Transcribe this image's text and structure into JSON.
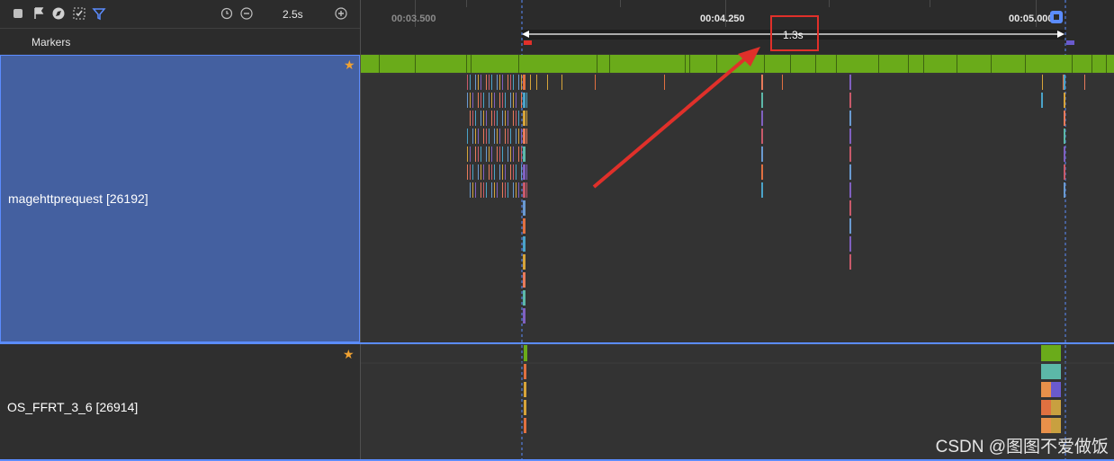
{
  "toolbar": {
    "icons": [
      "square-icon",
      "flag-icon",
      "compass-icon",
      "select-range-icon",
      "filter-icon",
      "reset-icon",
      "zoom-out-icon",
      "zoom-in-icon"
    ],
    "zoom_value": "2.5s"
  },
  "markers_label": "Markers",
  "ruler": {
    "ticks": [
      "00:03.500",
      "00:04.250",
      "00:05.000"
    ],
    "selection_duration": "1.3s"
  },
  "processes": [
    {
      "name": "magehttprequest [26192]",
      "starred": true
    },
    {
      "name": "OS_FFRT_3_6 [26914]",
      "starred": true
    }
  ],
  "colors": {
    "accent": "#5b8cff",
    "cpu_green": "#6aab1a",
    "highlight_red": "#e0302a",
    "panel_blue": "#4460a0"
  },
  "watermark": "CSDN @图图不爱做饭"
}
